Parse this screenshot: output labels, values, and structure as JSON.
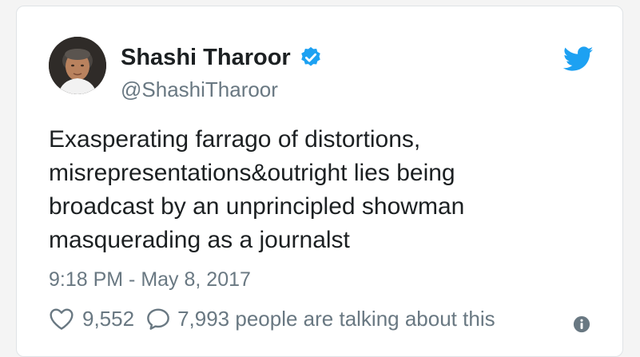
{
  "tweet": {
    "author_name": "Shashi Tharoor",
    "handle": "@ShashiTharoor",
    "text_lines": [
      "Exasperating farrago of distortions,",
      "misrepresentations&outright lies being",
      "broadcast by an unprincipled showman",
      "masquerading as a journalst"
    ],
    "timestamp": "9:18 PM - May 8, 2017",
    "like_count": "9,552",
    "talking_text": "7,993 people are talking about this"
  },
  "icons": {
    "verified": "verified-badge-icon",
    "brand": "twitter-bird-icon",
    "like": "heart-icon",
    "reply": "speech-bubble-icon",
    "info": "info-icon"
  },
  "colors": {
    "verified_blue": "#1da1f2",
    "brand_blue": "#1da1f2",
    "secondary_text": "#697882",
    "primary_text": "#1c2022"
  }
}
